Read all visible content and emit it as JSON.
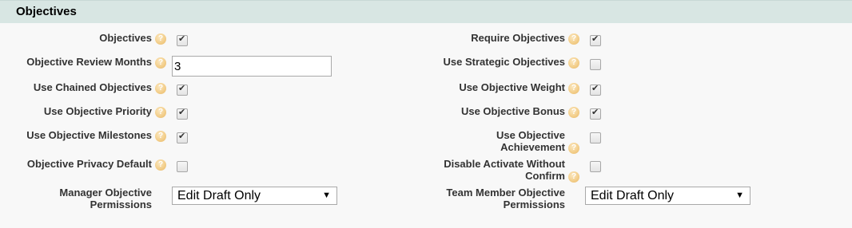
{
  "section": {
    "title": "Objectives"
  },
  "left": {
    "objectives": {
      "label": "Objectives",
      "checked": true
    },
    "review_months": {
      "label": "Objective Review Months",
      "value": "3"
    },
    "chained": {
      "label": "Use Chained Objectives",
      "checked": true
    },
    "priority": {
      "label": "Use Objective Priority",
      "checked": true
    },
    "milestones": {
      "label": "Use Objective Milestones",
      "checked": true
    },
    "privacy_default": {
      "label": "Objective Privacy Default",
      "checked": false
    },
    "manager_permissions": {
      "label_line1": "Manager Objective",
      "label_line2": "Permissions",
      "selected": "Edit Draft Only"
    }
  },
  "right": {
    "require": {
      "label": "Require Objectives",
      "checked": true
    },
    "strategic": {
      "label": "Use Strategic Objectives",
      "checked": false
    },
    "weight": {
      "label": "Use Objective Weight",
      "checked": true
    },
    "bonus": {
      "label": "Use Objective Bonus",
      "checked": true
    },
    "achievement": {
      "label_line1": "Use Objective",
      "label_line2": "Achievement",
      "checked": false
    },
    "disable_activate": {
      "label_line1": "Disable Activate Without",
      "label_line2": "Confirm",
      "checked": false
    },
    "team_permissions": {
      "label_line1": "Team Member Objective",
      "label_line2": "Permissions",
      "selected": "Edit Draft Only"
    }
  },
  "icons": {
    "help": "help-icon",
    "dropdown": "dropdown-arrow-icon"
  },
  "colors": {
    "header_bg": "#d8e6e3",
    "page_bg": "#f8f8f8",
    "help_icon": "#f3cf8c"
  }
}
